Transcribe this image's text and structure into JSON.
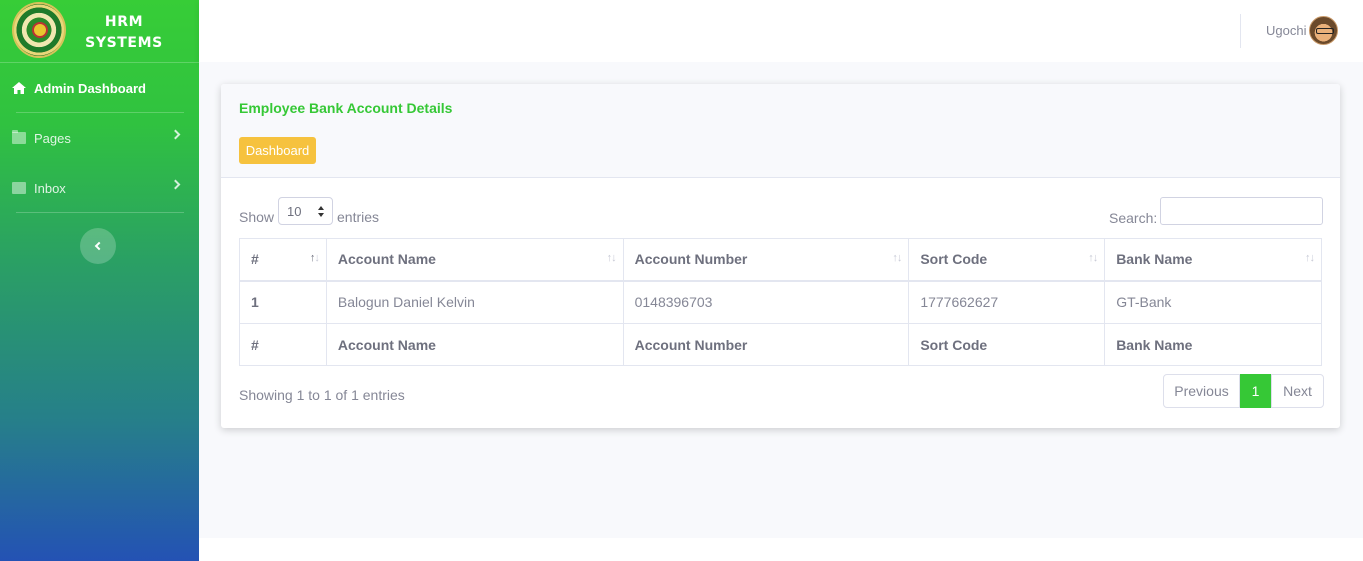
{
  "app": {
    "brand_line1": "HRM",
    "brand_line2": "SYSTEMS"
  },
  "sidebar": {
    "items": [
      {
        "label": "Admin Dashboard",
        "icon": "home-icon",
        "active": true
      },
      {
        "label": "Pages",
        "icon": "folder-icon"
      },
      {
        "label": "Inbox",
        "icon": "envelope-icon"
      }
    ]
  },
  "topbar": {
    "user_name": "Ugochi"
  },
  "card": {
    "title": "Employee Bank Account Details",
    "dashboard_button": "Dashboard"
  },
  "table_controls": {
    "show_label": "Show",
    "entries_value": "10",
    "entries_label": "entries",
    "search_label": "Search:",
    "search_value": ""
  },
  "table": {
    "columns": [
      "#",
      "Account Name",
      "Account Number",
      "Sort Code",
      "Bank Name"
    ],
    "rows": [
      [
        "1",
        "Balogun Daniel Kelvin",
        "0148396703",
        "1777662627",
        "GT-Bank"
      ]
    ]
  },
  "footer": {
    "showing": "Showing 1 to 1 of 1 entries",
    "previous": "Previous",
    "current_page": "1",
    "next": "Next"
  },
  "colors": {
    "brand_green": "#36c836",
    "button_yellow": "#f6c23e"
  }
}
